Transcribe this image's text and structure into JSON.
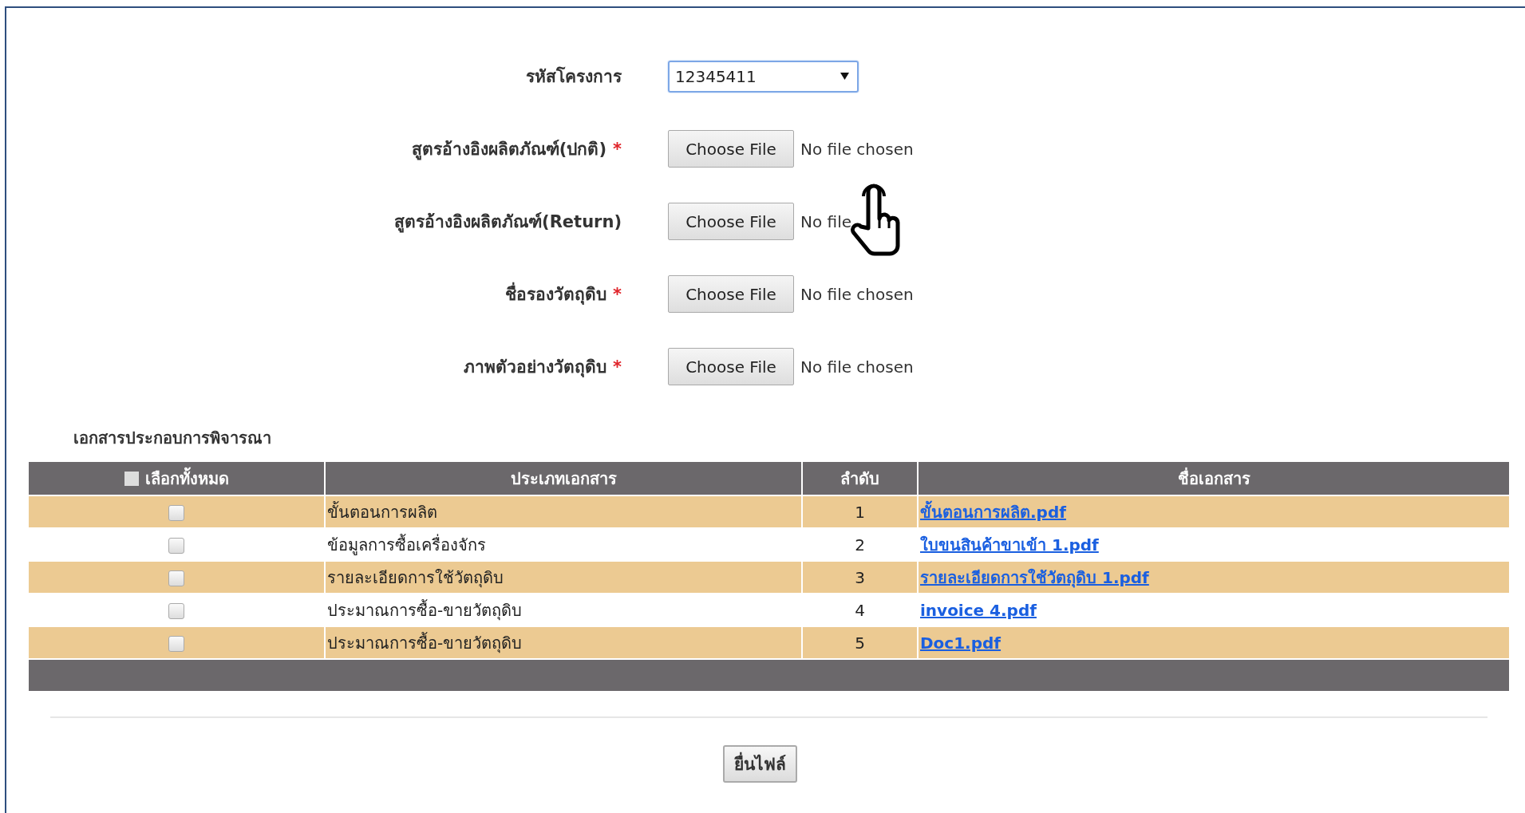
{
  "form": {
    "fields": [
      {
        "kind": "select",
        "label": "รหัสโครงการ",
        "value": "12345411"
      },
      {
        "kind": "file",
        "label": "สูตรอ้างอิงผลิตภัณฑ์(ปกติ)",
        "required_mark": "*",
        "button": "Choose File",
        "status": "No file chosen"
      },
      {
        "kind": "file",
        "label": "สูตรอ้างอิงผลิตภัณฑ์(Return)",
        "button": "Choose File",
        "status": "No file"
      },
      {
        "kind": "file",
        "label": "ชื่อรองวัตถุดิบ",
        "required_mark": "*",
        "button": "Choose File",
        "status": "No file chosen"
      },
      {
        "kind": "file",
        "label": "ภาพตัวอย่างวัตถุดิบ",
        "required_mark": "*",
        "button": "Choose File",
        "status": "No file chosen"
      }
    ]
  },
  "documents": {
    "title": "เอกสารประกอบการพิจารณา",
    "select_all": {
      "label": "เลือกทั้งหมด",
      "checked": false
    },
    "columns": [
      "ประเภทเอกสาร",
      "ลำดับ",
      "ชื่อเอกสาร"
    ],
    "rows": [
      {
        "checked": false,
        "type": "ขั้นตอนการผลิต",
        "order": "1",
        "file": "ขั้นตอนการผลิต.pdf"
      },
      {
        "checked": false,
        "type": "ข้อมูลการซื้อเครื่องจักร",
        "order": "2",
        "file": "ใบขนสินค้าขาเข้า 1.pdf"
      },
      {
        "checked": false,
        "type": "รายละเอียดการใช้วัตถุดิบ",
        "order": "3",
        "file": "รายละเอียดการใช้วัตถุดิบ 1.pdf"
      },
      {
        "checked": false,
        "type": "ประมาณการซื้อ-ขายวัตถุดิบ",
        "order": "4",
        "file": "invoice 4.pdf"
      },
      {
        "checked": false,
        "type": "ประมาณการซื้อ-ขายวัตถุดิบ",
        "order": "5",
        "file": "Doc1.pdf"
      }
    ]
  },
  "submit": {
    "label": "ยื่นไฟล์"
  }
}
